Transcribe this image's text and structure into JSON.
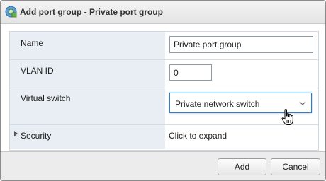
{
  "dialog": {
    "title": "Add port group - Private port group",
    "title_icon": "port-group-icon"
  },
  "form": {
    "name": {
      "label": "Name",
      "value": "Private port group"
    },
    "vlan": {
      "label": "VLAN ID",
      "value": "0"
    },
    "virtual_switch": {
      "label": "Virtual switch",
      "selected": "Private network switch",
      "dropdown_icon": "chevron-down-icon"
    },
    "security": {
      "label": "Security",
      "value": "Click to expand",
      "expand_icon": "caret-right-icon"
    }
  },
  "footer": {
    "add_label": "Add",
    "cancel_label": "Cancel"
  },
  "cursor": "hand-pointer-icon"
}
